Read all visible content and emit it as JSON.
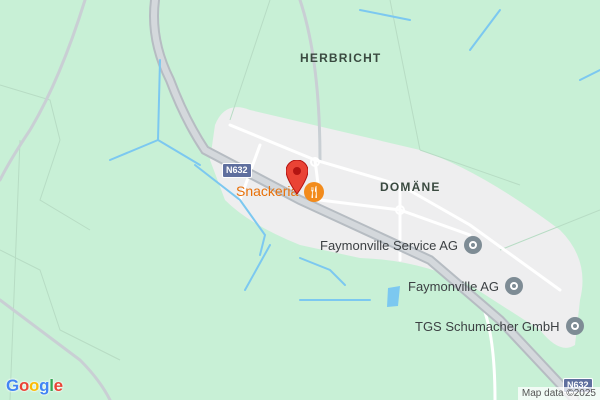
{
  "map": {
    "area_labels": {
      "herbricht": "HERBRICHT",
      "domaene": "DOMÄNE"
    },
    "road_shields": {
      "main": "N632",
      "bottom": "N632"
    },
    "restaurant": {
      "name": "Snackeria",
      "icon": "restaurant-icon"
    },
    "pois": [
      {
        "name": "Faymonville Service AG",
        "icon": "business-pin-icon"
      },
      {
        "name": "Faymonville AG",
        "icon": "business-pin-icon"
      },
      {
        "name": "TGS Schumacher GmbH",
        "icon": "business-pin-icon"
      }
    ],
    "attribution": "Map data ©2025",
    "logo": "Google",
    "colors": {
      "land": "#c8f0d6",
      "builtup": "#eeeeef",
      "water": "#7cc8f0",
      "marker": "#ea4335",
      "restaurant": "#e8710a"
    }
  }
}
